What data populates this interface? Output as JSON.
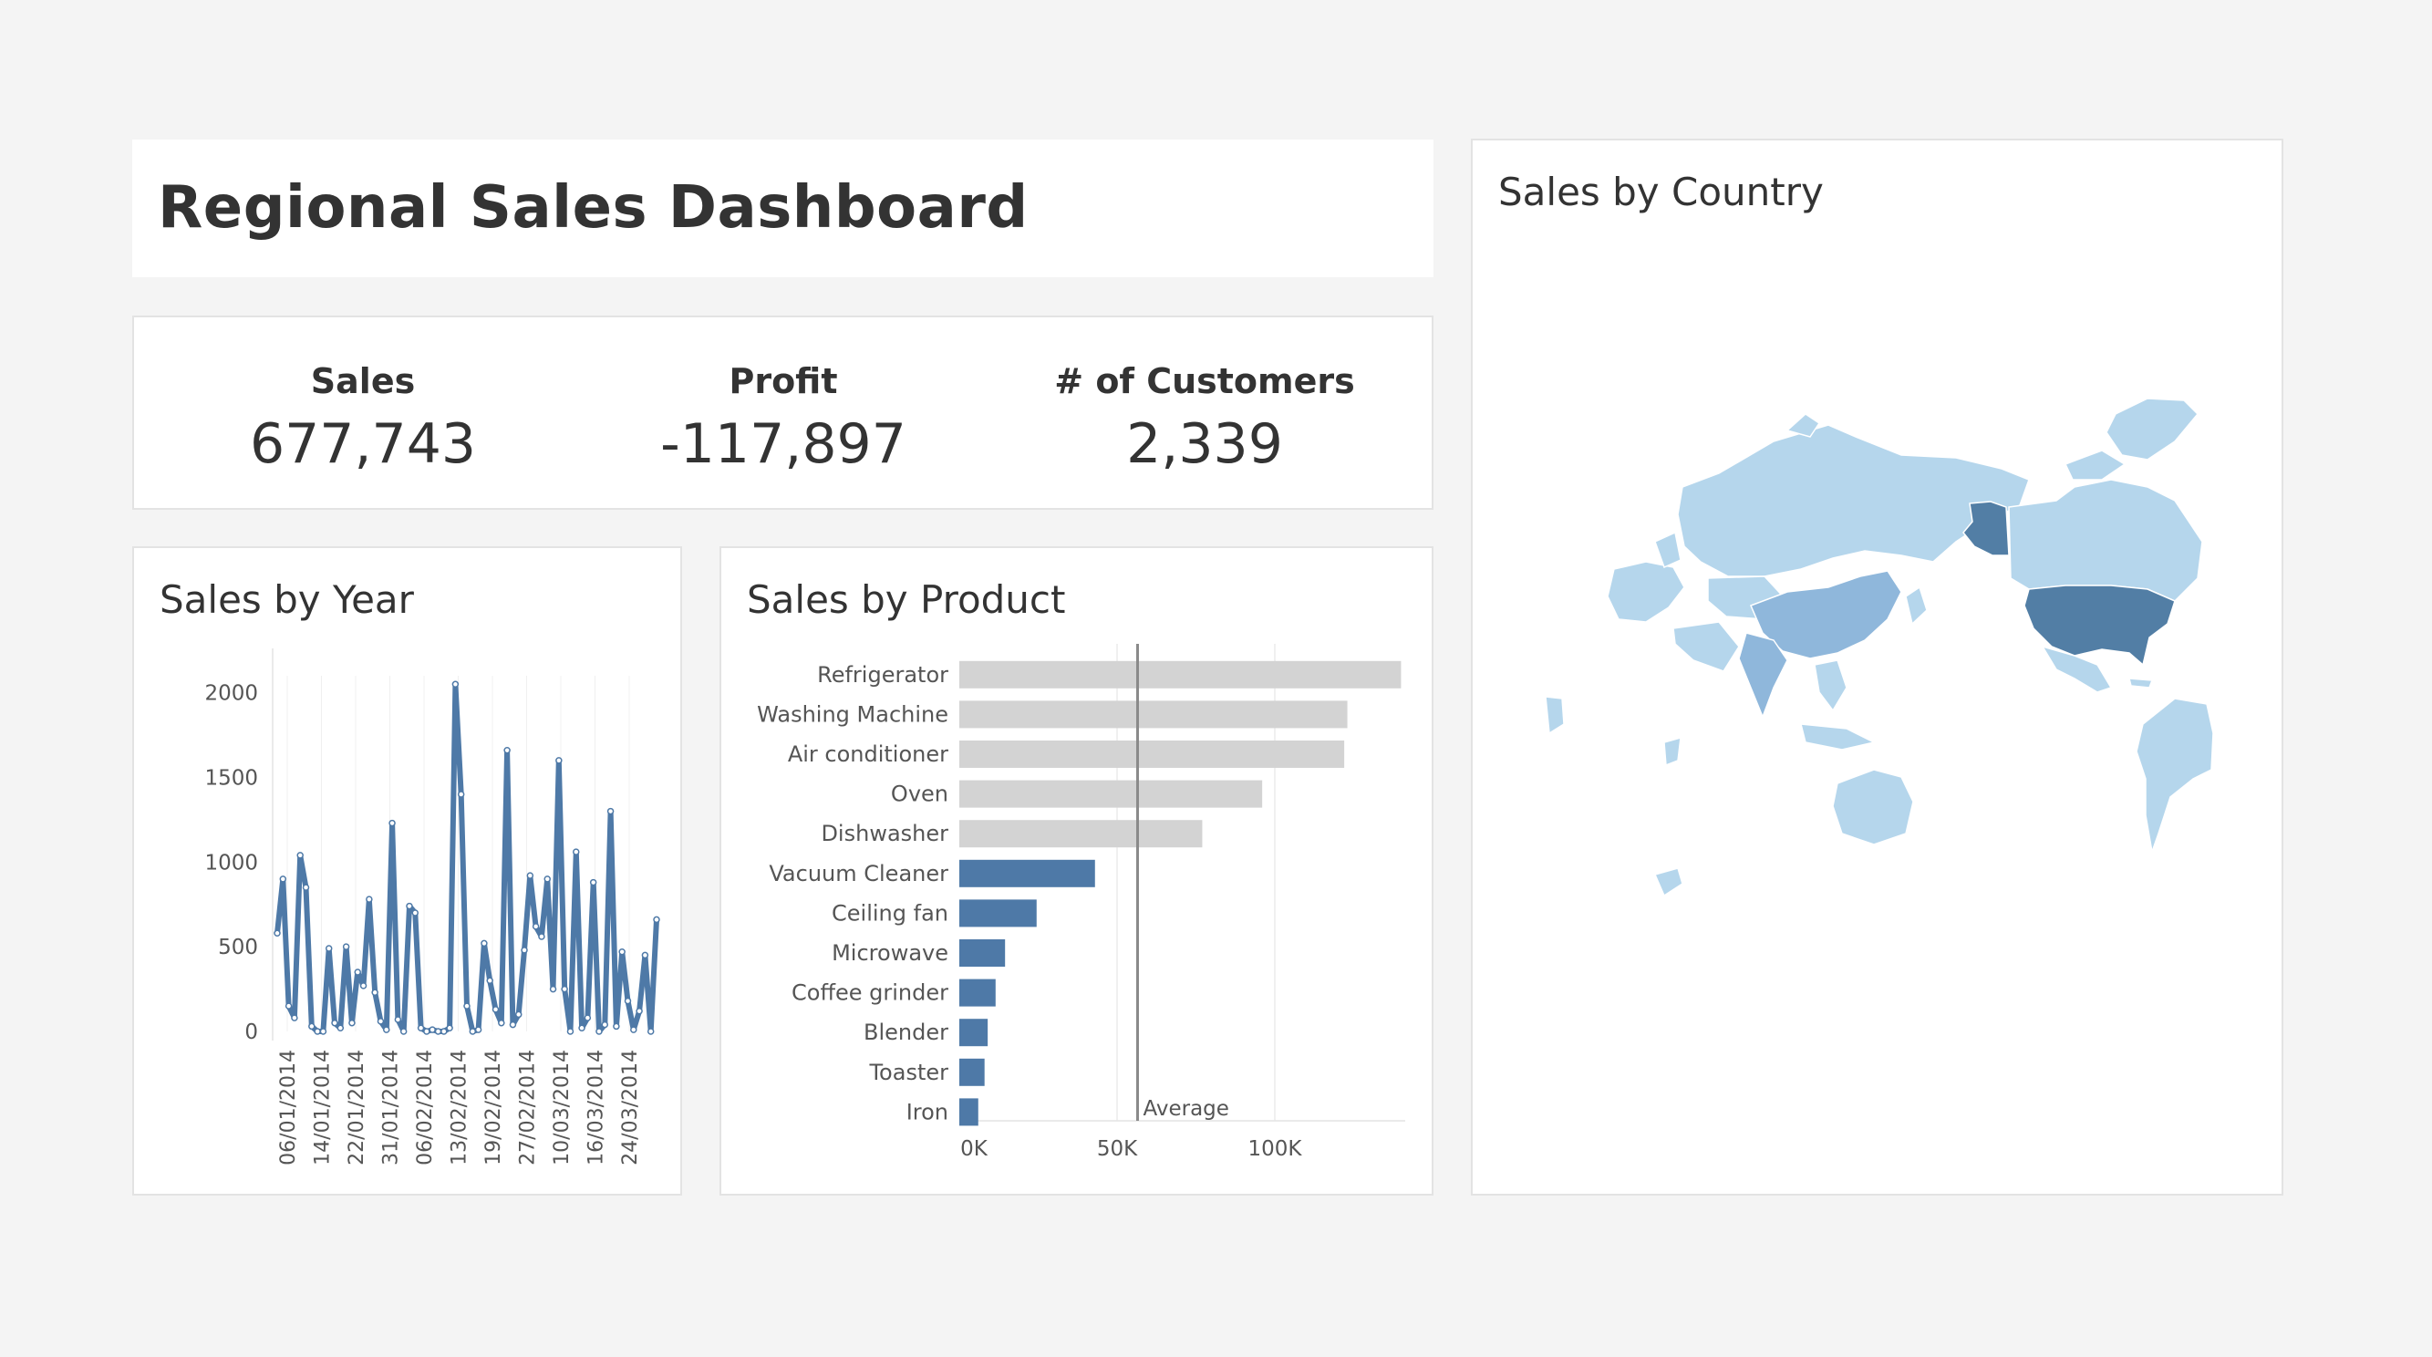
{
  "dashboard": {
    "title": "Regional Sales Dashboard"
  },
  "kpis": [
    {
      "label": "Sales",
      "value": "677,743"
    },
    {
      "label": "Profit",
      "value": "-117,897"
    },
    {
      "label": "# of Customers",
      "value": "2,339"
    }
  ],
  "map": {
    "title": "Sales by Country",
    "colors": {
      "light": "#b5d6ec",
      "medium": "#8fb7db",
      "dark": "#527ea5"
    }
  },
  "chart_data": [
    {
      "type": "line",
      "title": "Sales by Year",
      "xlabel": "",
      "ylabel": "",
      "ylim": [
        0,
        2100
      ],
      "yticks": [
        "2000",
        "1500",
        "1000",
        "500",
        "0"
      ],
      "xticks": [
        "06/01/2014",
        "14/01/2014",
        "22/01/2014",
        "31/01/2014",
        "06/02/2014",
        "13/02/2014",
        "19/02/2014",
        "27/02/2014",
        "10/03/2014",
        "16/03/2014",
        "24/03/2014"
      ],
      "color": "#4e79a7",
      "grid": true,
      "series": [
        {
          "values": [
            580,
            900,
            150,
            80,
            1040,
            850,
            30,
            0,
            0,
            490,
            50,
            20,
            500,
            50,
            350,
            270,
            780,
            230,
            60,
            10,
            1230,
            70,
            0,
            740,
            700,
            20,
            0,
            10,
            0,
            0,
            20,
            2050,
            1400,
            150,
            0,
            10,
            520,
            300,
            130,
            50,
            1660,
            40,
            100,
            480,
            920,
            620,
            560,
            900,
            250,
            1600,
            250,
            0,
            1060,
            20,
            80,
            880,
            0,
            40,
            1300,
            30,
            470,
            180,
            10,
            120,
            450,
            0,
            660
          ]
        }
      ]
    },
    {
      "type": "bar",
      "orientation": "horizontal",
      "title": "Sales by Product",
      "xlabel": "",
      "ylabel": "",
      "xlim": [
        0,
        150000
      ],
      "xticks": [
        "0K",
        "50K",
        "100K"
      ],
      "categories": [
        "Refrigerator",
        "Washing Machine",
        "Air conditioner",
        "Oven",
        "Dishwasher",
        "Vacuum Cleaner",
        "Ceiling fan",
        "Microwave",
        "Coffee grinder",
        "Blender",
        "Toaster",
        "Iron"
      ],
      "values": [
        140000,
        123000,
        122000,
        96000,
        77000,
        43000,
        24500,
        14500,
        11500,
        9000,
        8000,
        6000
      ],
      "reference_line": {
        "label": "Average",
        "value": 56500
      },
      "colors": {
        "above_average": "#d3d3d3",
        "below_average": "#4e79a7"
      },
      "grid": true
    }
  ]
}
